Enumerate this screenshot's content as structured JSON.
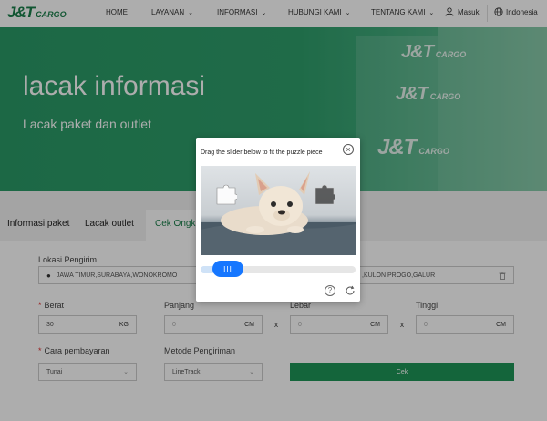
{
  "header": {
    "logo": "J&T",
    "logo_sub": "CARGO",
    "nav": [
      {
        "label": "HOME",
        "chevron": false
      },
      {
        "label": "LAYANAN",
        "chevron": true
      },
      {
        "label": "INFORMASI",
        "chevron": true
      },
      {
        "label": "HUBUNGI KAMI",
        "chevron": true
      },
      {
        "label": "TENTANG KAMI",
        "chevron": true
      }
    ],
    "login_label": "Masuk",
    "language": "Indonesia"
  },
  "hero": {
    "title": "lacak informasi",
    "subtitle": "Lacak paket dan outlet",
    "brand_text": "J&T",
    "brand_sub": "CARGO"
  },
  "tabs": [
    {
      "label": "Informasi paket",
      "active": false
    },
    {
      "label": "Lacak outlet",
      "active": false
    },
    {
      "label": "Cek Ongkir",
      "active": true
    }
  ],
  "form": {
    "sender_label": "Lokasi Pengirim",
    "sender_value": "JAWA TIMUR,SURABAYA,WONOKROMO",
    "receiver_value": ",KULON PROGO,GALUR",
    "weight_label": "Berat",
    "weight_value": "30",
    "weight_unit": "KG",
    "length_label": "Panjang",
    "length_value": "0",
    "width_label": "Lebar",
    "width_value": "0",
    "height_label": "Tinggi",
    "height_value": "0",
    "dim_unit": "CM",
    "times": "x",
    "payment_label": "Cara pembayaran",
    "payment_value": "Tunai",
    "method_label": "Metode Pengiriman",
    "method_value": "LineTrack",
    "submit_label": "Cek"
  },
  "captcha": {
    "instruction": "Drag the slider below to fit the puzzle piece",
    "close_icon": "close-icon",
    "handle_glyph": "III",
    "help_glyph": "?",
    "slider_progress": 0.11
  },
  "colors": {
    "brand_green": "#1a7f4b",
    "button_green": "#1e9658",
    "slider_blue": "#1677ff",
    "required_red": "#e03030"
  }
}
